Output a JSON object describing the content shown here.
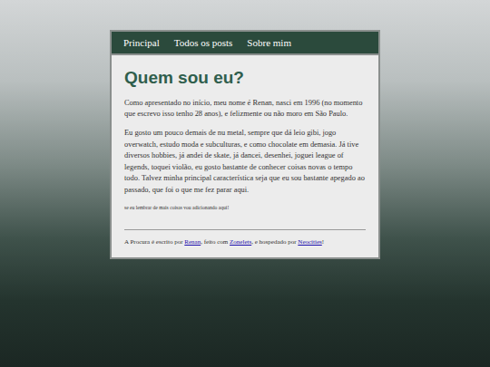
{
  "nav": [
    {
      "label": "Principal"
    },
    {
      "label": "Todos os posts"
    },
    {
      "label": "Sobre mim"
    }
  ],
  "title": "Quem sou eu?",
  "paragraphs": [
    "Como apresentado no início, meu nome é Renan, nasci em 1996 (no momento que escrevo isso tenho 28 anos), e felizmente ou não moro em São Paulo.",
    "Eu gosto um pouco demais de nu metal, sempre que dá leio gibi, jogo overwatch, estudo moda e subculturas, e como chocolate em demasia. Já tive diversos hobbies, já andei de skate, já dancei, desenhei, joguei league of legends, toquei violão, eu gosto bastante de conhecer coisas novas o tempo todo. Talvez minha principal característica seja que eu sou bastante apegado ao passado, que foi o que me fez parar aqui."
  ],
  "note": "se eu lembrar de mais coisas vou adicionando aqui!",
  "footer": [
    {
      "kind": "text",
      "text": "A Procura é escrito por "
    },
    {
      "kind": "link",
      "text": "Renan"
    },
    {
      "kind": "text",
      "text": ", feito com "
    },
    {
      "kind": "link",
      "text": "Zonelets"
    },
    {
      "kind": "text",
      "text": ", e hospedado por "
    },
    {
      "kind": "link",
      "text": "Neocities"
    },
    {
      "kind": "text",
      "text": "!"
    }
  ]
}
